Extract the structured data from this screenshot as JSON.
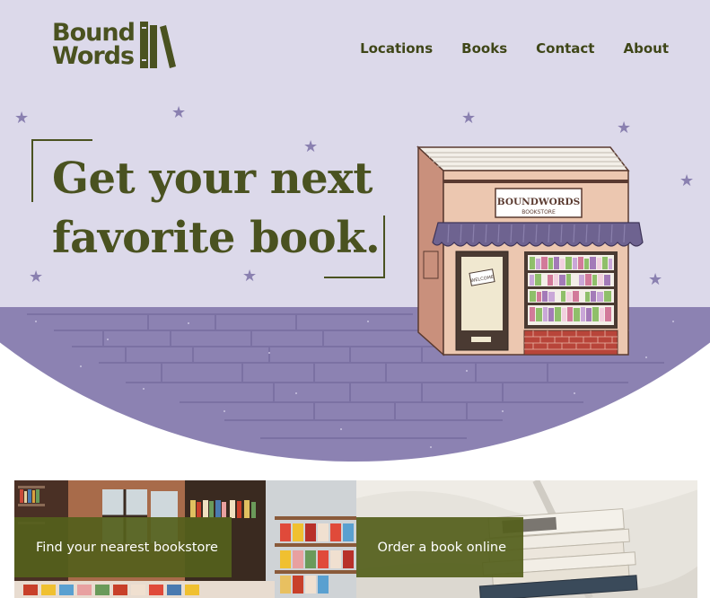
{
  "brand": {
    "logo_line1": "Bound",
    "logo_line2": "Words"
  },
  "nav": {
    "items": [
      "Locations",
      "Books",
      "Contact",
      "About"
    ]
  },
  "hero": {
    "headline_line1": "Get your next",
    "headline_line2": "favorite book."
  },
  "storefront": {
    "sign_main": "BOUNDWORDS",
    "sign_sub": "BOOKSTORE",
    "door_sign": "WELCOME"
  },
  "cards": [
    {
      "label": "Find your nearest bookstore"
    },
    {
      "label": "Order a book online"
    }
  ],
  "colors": {
    "hero_background": "#dcd9ea",
    "pavement": "#8c82b2",
    "accent_olive": "#4a5220",
    "card_overlay": "#54601c",
    "star": "#8a80b0"
  }
}
